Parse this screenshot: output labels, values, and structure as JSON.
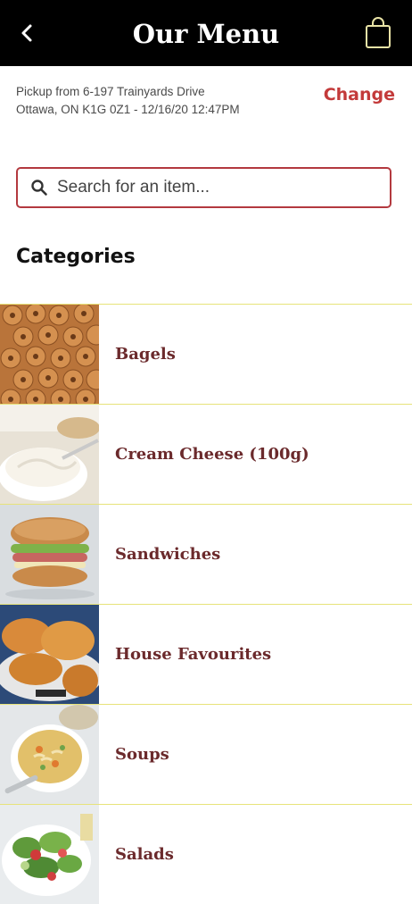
{
  "header": {
    "title": "Our Menu",
    "back_icon": "chevron-left-icon",
    "cart_icon": "shopping-bag-icon"
  },
  "pickup": {
    "line1": "Pickup from 6-197 Trainyards Drive",
    "line2": "Ottawa, ON K1G 0Z1 - 12/16/20 12:47PM",
    "change_label": "Change"
  },
  "search": {
    "placeholder": "Search for an item...",
    "value": ""
  },
  "categories": {
    "heading": "Categories",
    "items": [
      {
        "label": "Bagels"
      },
      {
        "label": "Cream Cheese (100g)"
      },
      {
        "label": "Sandwiches"
      },
      {
        "label": "House Favourites"
      },
      {
        "label": "Soups"
      },
      {
        "label": "Salads"
      }
    ]
  },
  "colors": {
    "header_bg": "#000000",
    "accent": "#c33a3a",
    "category_text": "#6b2a2c",
    "divider": "#e7e37a"
  }
}
